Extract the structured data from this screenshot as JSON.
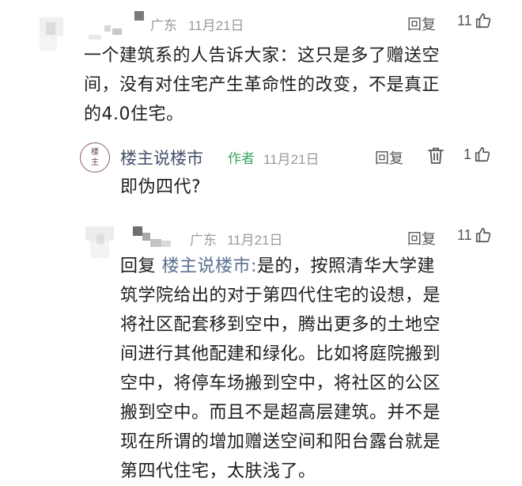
{
  "comments": [
    {
      "location": "广东",
      "date": "11月21日",
      "reply_label": "回复",
      "likes": "11",
      "text": "一个建筑系的人告诉大家：这只是多了赠送空间，没有对住宅产生革命性的改变，不是真正的4.0住宅。",
      "lines": [
        "一个建筑系的人告诉大家：这只是多了赠送空",
        "间，没有对住宅产生革命性的改变，不是真正",
        "的4.0住宅。"
      ]
    },
    {
      "author": "楼主说楼市",
      "avatar_text": [
        "楼",
        "主"
      ],
      "author_tag": "作者",
      "date": "11月21日",
      "reply_label": "回复",
      "likes": "1",
      "text": "即伪四代?"
    },
    {
      "location": "广东",
      "date": "11月21日",
      "reply_label": "回复",
      "likes": "11",
      "reply_prefix": "回复",
      "reply_target": "楼主说楼市:",
      "first_line_rest": "是的，按照清华大学建",
      "lines": [
        "筑学院给出的对于第四代住宅的设想，是",
        "将社区配套移到空中，腾出更多的土地空",
        "间进行其他配建和绿化。比如将庭院搬到",
        "空中，将停车场搬到空中，将社区的公区",
        "搬到空中。而且不是超高层建筑。并不是",
        "现在所谓的增加赠送空间和阳台露台就是",
        "第四代住宅，太肤浅了。"
      ]
    }
  ],
  "icons": {
    "like": "thumbs-up-icon",
    "delete": "trash-icon"
  },
  "colors": {
    "author_name": "#44506a",
    "author_tag": "#3aa564",
    "meta": "#9a9a9a"
  }
}
